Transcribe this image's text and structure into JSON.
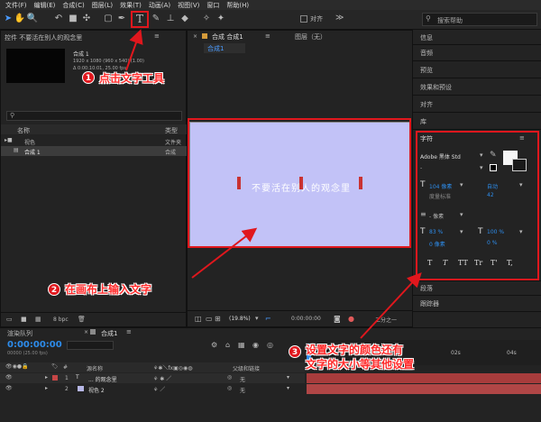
{
  "menu": [
    "文件(F)",
    "编辑(E)",
    "合成(C)",
    "图层(L)",
    "效果(T)",
    "动画(A)",
    "视图(V)",
    "窗口",
    "帮助(H)"
  ],
  "toolbar": {
    "align_label": "对齐",
    "search_placeholder": "搜索帮助"
  },
  "project": {
    "title": "控件 不要活在别人的观念里",
    "comp_name": "合成 1",
    "comp_info1": "1920 x 1080  (960 x 540) (1.00)",
    "comp_info2": "Δ 0:00:10:01, 25.00 fps",
    "col_name": "名称",
    "col_type": "类型",
    "items": [
      {
        "name": "视色",
        "type": "文件夹"
      },
      {
        "name": "合成 1",
        "type": "合成"
      }
    ],
    "bpc": "8 bpc"
  },
  "viewer": {
    "tab_comp": "合成 合成1",
    "tab_layer": "图层（无）",
    "sub_tab": "合成1",
    "canvas_text": "不要活在别人的观念里",
    "zoom": "(19.8%)",
    "timecode": "0:00:00:00",
    "resolution": "二分之一"
  },
  "right": {
    "items_top": [
      "信息",
      "音频",
      "预览",
      "效果和预设",
      "对齐",
      "库"
    ],
    "character_title": "字符",
    "font": "Adobe 黑体 Std",
    "font_style": "-",
    "size": "104 像素",
    "leading": "自动",
    "kerning": "度量标准",
    "tracking": "42",
    "stroke": "- 像素",
    "vscale": "83 %",
    "hscale": "100 %",
    "baseline": "0 像素",
    "tsume": "0 %",
    "styles": [
      "T",
      "T",
      "TT",
      "Tr",
      "T'",
      "T,"
    ],
    "items_bottom": [
      "段落",
      "跟踪器"
    ]
  },
  "timeline": {
    "tab_render": "渲染队列",
    "tab_comp": "合成1",
    "timecode": "0:00:00:00",
    "fps_info": "00000 (25.00 fps)",
    "col_name": "源名称",
    "col_parent": "父级和链接",
    "ruler": [
      "0s",
      "02s",
      "04s"
    ],
    "layers": [
      {
        "num": "1",
        "type": "T",
        "name": "... 的观念里",
        "parent": "无",
        "color": "#c64646"
      },
      {
        "num": "2",
        "type": "",
        "name": "视色 2",
        "parent": "无",
        "color": "#9a9ad6"
      }
    ]
  },
  "annotations": [
    {
      "num": "1",
      "text": "点击文字工具"
    },
    {
      "num": "2",
      "text": "在画布上输入文字"
    },
    {
      "num": "3",
      "text": "设置文字的颜色还有\n文字的大小等其他设置"
    }
  ]
}
